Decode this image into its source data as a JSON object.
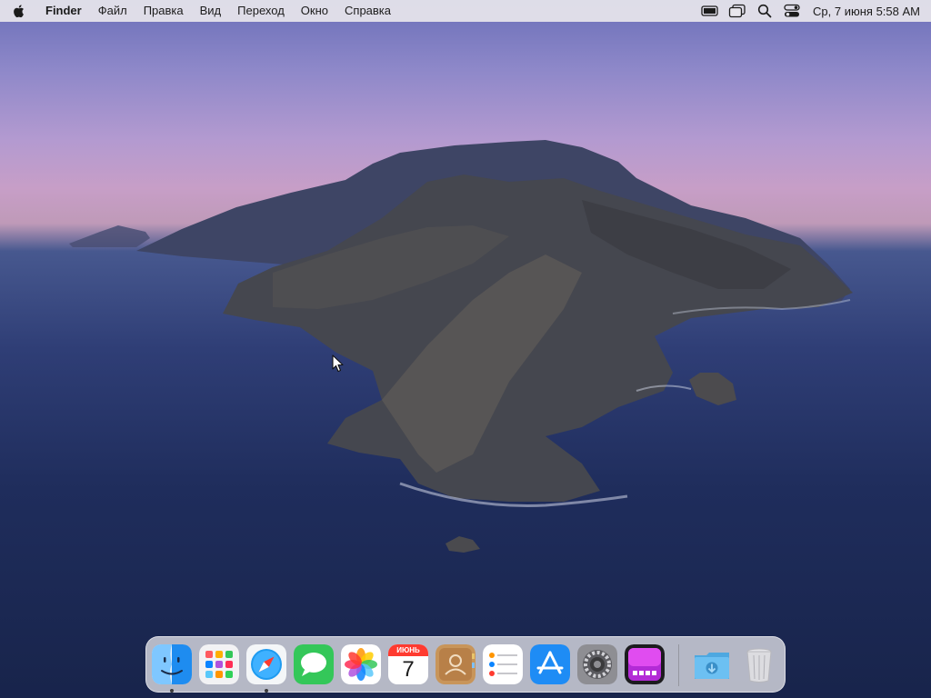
{
  "menubar": {
    "app_name": "Finder",
    "items": [
      {
        "label": "Файл"
      },
      {
        "label": "Правка"
      },
      {
        "label": "Вид"
      },
      {
        "label": "Переход"
      },
      {
        "label": "Окно"
      },
      {
        "label": "Справка"
      }
    ],
    "status_icons": [
      "battery-icon",
      "window-switcher-icon",
      "search-icon",
      "control-center-icon"
    ],
    "clock": "Ср, 7 июня  5:58 AM"
  },
  "dock": {
    "apps": [
      {
        "name": "finder-icon",
        "running": true
      },
      {
        "name": "launchpad-icon",
        "running": false
      },
      {
        "name": "safari-icon",
        "running": true
      },
      {
        "name": "messages-icon",
        "running": false
      },
      {
        "name": "photos-icon",
        "running": false
      },
      {
        "name": "calendar-icon",
        "running": false
      },
      {
        "name": "contacts-icon",
        "running": false
      },
      {
        "name": "reminders-icon",
        "running": false
      },
      {
        "name": "app-store-icon",
        "running": false
      },
      {
        "name": "system-preferences-icon",
        "running": false
      },
      {
        "name": "screen-manager-icon",
        "running": false
      }
    ],
    "calendar": {
      "month": "ИЮНЬ",
      "day": "7"
    },
    "utilities": [
      {
        "name": "downloads-folder-icon"
      },
      {
        "name": "trash-icon"
      }
    ]
  },
  "colors": {
    "menubar_bg": "#e8e6ec",
    "dock_bg": "#e1e1e8",
    "sky_top": "#6a6fb8",
    "sky_horizon": "#c79ec7",
    "sea": "#1f2d5c"
  }
}
